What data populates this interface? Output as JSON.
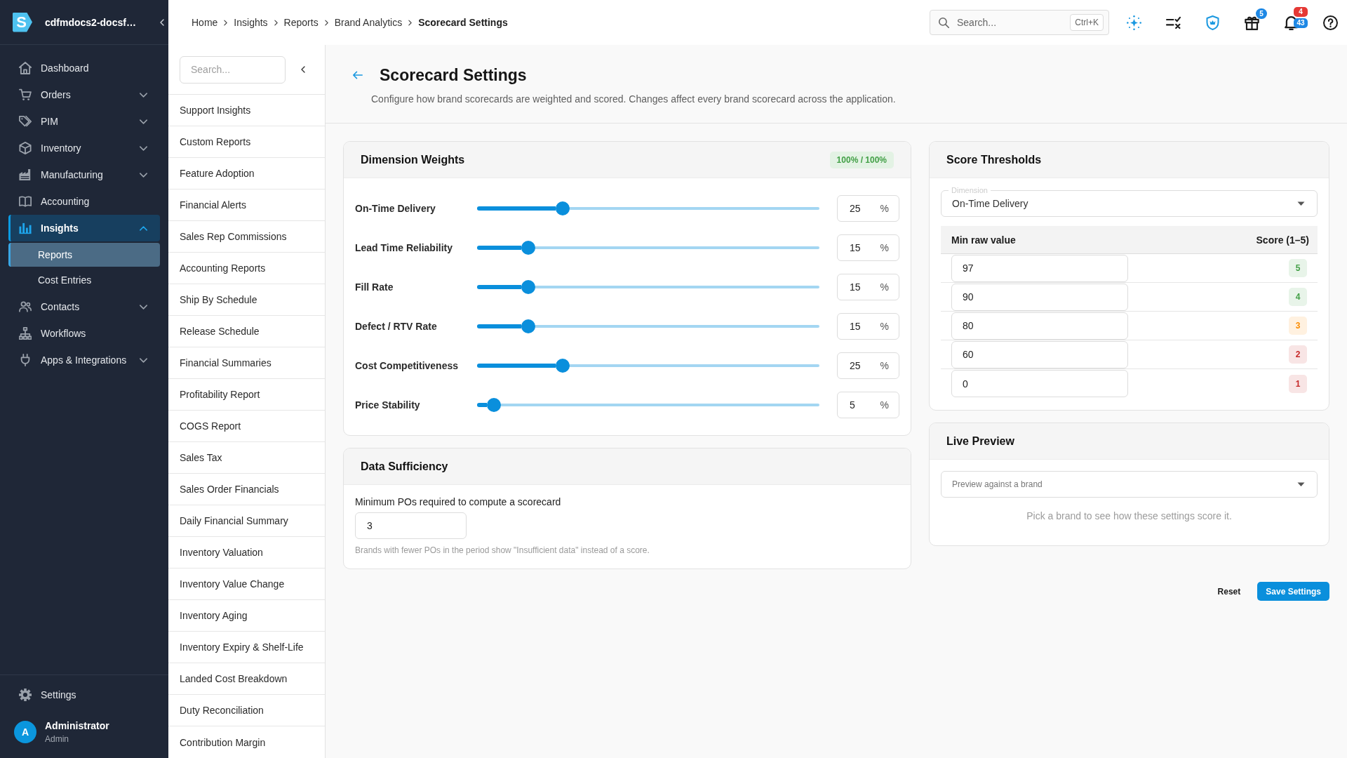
{
  "sidebar": {
    "logo": "S",
    "workspace": "cdfmdocs2-docsf…",
    "items": [
      {
        "label": "Dashboard",
        "kind": "link",
        "selected": false
      },
      {
        "label": "Orders",
        "kind": "group",
        "expanded": false,
        "selected": false
      },
      {
        "label": "PIM",
        "kind": "group",
        "expanded": false,
        "selected": false
      },
      {
        "label": "Inventory",
        "kind": "group",
        "expanded": false,
        "selected": false
      },
      {
        "label": "Manufacturing",
        "kind": "group",
        "expanded": false,
        "selected": false
      },
      {
        "label": "Accounting",
        "kind": "link",
        "selected": false
      },
      {
        "label": "Insights",
        "kind": "group",
        "expanded": true,
        "selected": true,
        "children": [
          {
            "label": "Reports",
            "selected": true
          },
          {
            "label": "Cost Entries",
            "selected": false
          }
        ]
      },
      {
        "label": "Contacts",
        "kind": "group",
        "expanded": false,
        "selected": false
      },
      {
        "label": "Workflows",
        "kind": "link",
        "selected": false
      },
      {
        "label": "Apps & Integrations",
        "kind": "group",
        "expanded": false,
        "selected": false
      }
    ],
    "settings": "Settings",
    "user": {
      "initial": "A",
      "name": "Administrator",
      "role": "Admin"
    }
  },
  "top_bar": {
    "breadcrumb": [
      {
        "label": "Home",
        "current": false
      },
      {
        "label": "Insights",
        "current": false
      },
      {
        "label": "Reports",
        "current": false
      },
      {
        "label": "Brand Analytics",
        "current": false
      },
      {
        "label": "Scorecard Settings",
        "current": true
      }
    ],
    "search": {
      "placeholder": "Search...",
      "shortcut": "Ctrl+K"
    },
    "gift_badge": "5",
    "notification_badges": [
      {
        "text": "4",
        "color": "#e53935"
      },
      {
        "text": "43",
        "color": "#1e88e5"
      }
    ]
  },
  "reports_nav": {
    "search": {
      "placeholder": "Search..."
    },
    "items": [
      {
        "label": "Support Insights",
        "selected": false
      },
      {
        "label": "Custom Reports",
        "selected": false
      },
      {
        "label": "Feature Adoption",
        "selected": false
      },
      {
        "label": "Financial Alerts",
        "selected": false
      },
      {
        "label": "Sales Rep Commissions",
        "selected": false
      },
      {
        "label": "Accounting Reports",
        "selected": false
      },
      {
        "label": "Ship By Schedule",
        "selected": false
      },
      {
        "label": "Release Schedule",
        "selected": false
      },
      {
        "label": "Financial Summaries",
        "selected": false
      },
      {
        "label": "Profitability Report",
        "selected": false
      },
      {
        "label": "COGS Report",
        "selected": false
      },
      {
        "label": "Sales Tax",
        "selected": false
      },
      {
        "label": "Sales Order Financials",
        "selected": false
      },
      {
        "label": "Daily Financial Summary",
        "selected": false
      },
      {
        "label": "Inventory Valuation",
        "selected": false
      },
      {
        "label": "Inventory Value Change",
        "selected": false
      },
      {
        "label": "Inventory Aging",
        "selected": false
      },
      {
        "label": "Inventory Expiry & Shelf-Life",
        "selected": false
      },
      {
        "label": "Landed Cost Breakdown",
        "selected": false
      },
      {
        "label": "Duty Reconciliation",
        "selected": false
      },
      {
        "label": "Contribution Margin",
        "selected": false
      }
    ]
  },
  "page": {
    "title": "Scorecard Settings",
    "description": "Configure how brand scorecards are weighted and scored. Changes affect every brand scorecard across the application."
  },
  "dimension_weights": {
    "title": "Dimension Weights",
    "total": "100% / 100%",
    "rows": [
      {
        "name": "On-Time Delivery",
        "level": 0.25,
        "value": "25",
        "unit": "%"
      },
      {
        "name": "Lead Time Reliability",
        "level": 0.15,
        "value": "15",
        "unit": "%"
      },
      {
        "name": "Fill Rate",
        "level": 0.15,
        "value": "15",
        "unit": "%"
      },
      {
        "name": "Defect / RTV Rate",
        "level": 0.15,
        "value": "15",
        "unit": "%"
      },
      {
        "name": "Cost Competitiveness",
        "level": 0.25,
        "value": "25",
        "unit": "%"
      },
      {
        "name": "Price Stability",
        "level": 0.05,
        "value": "5",
        "unit": "%"
      }
    ]
  },
  "data_sufficiency": {
    "title": "Data Sufficiency",
    "label": "Minimum POs required to compute a scorecard",
    "value": "3",
    "hint": "Brands with fewer POs in the period show \"Insufficient data\" instead of a score."
  },
  "score_thresholds": {
    "title": "Score Thresholds",
    "dimension": {
      "label": "Dimension",
      "value": "On-Time Delivery"
    },
    "columns": [
      "Min raw value",
      "Score (1–5)"
    ],
    "rows": [
      {
        "min": "97",
        "score": "5",
        "color": "#43a047"
      },
      {
        "min": "90",
        "score": "4",
        "color": "#43a047"
      },
      {
        "min": "80",
        "score": "3",
        "color": "#fb8c00"
      },
      {
        "min": "60",
        "score": "2",
        "color": "#c62828"
      },
      {
        "min": "0",
        "score": "1",
        "color": "#c62828"
      }
    ]
  },
  "live_preview": {
    "title": "Live Preview",
    "brand_select": {
      "placeholder": "Preview against a brand"
    },
    "empty_message": "Pick a brand to see how these settings score it."
  },
  "actions": [
    {
      "label": "Reset",
      "kind": "text"
    },
    {
      "label": "Save Settings",
      "kind": "primary"
    }
  ]
}
